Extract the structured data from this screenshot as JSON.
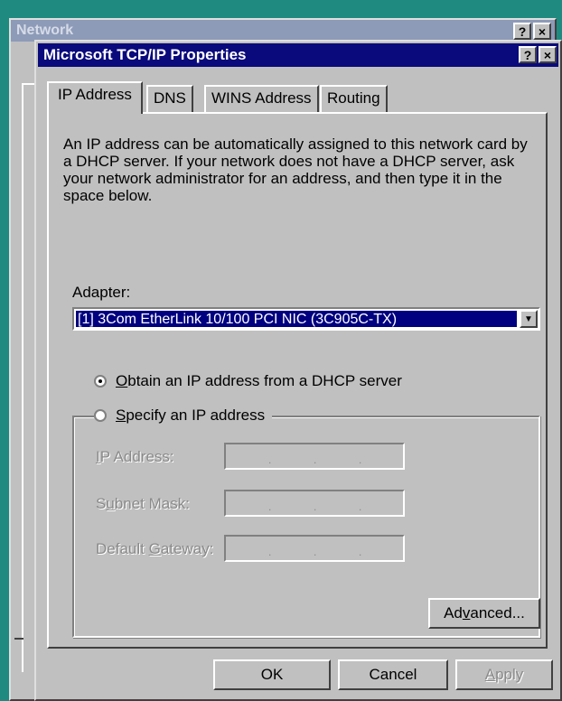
{
  "background_window": {
    "title": "Network",
    "help_label": "?",
    "close_label": "×"
  },
  "dialog": {
    "title": "Microsoft TCP/IP Properties",
    "help_label": "?",
    "close_label": "×"
  },
  "tabs": [
    {
      "label": "IP Address",
      "active": true
    },
    {
      "label": "DNS",
      "active": false
    },
    {
      "label": "WINS Address",
      "active": false
    },
    {
      "label": "Routing",
      "active": false
    }
  ],
  "description": "An IP address can be automatically assigned to this network card by a DHCP server.  If your network does not have a DHCP server, ask your network administrator for an address, and then type it in the space below.",
  "adapter": {
    "label": "Adapter:",
    "selected": "[1] 3Com EtherLink 10/100 PCI NIC (3C905C-TX)",
    "arrow": "▼"
  },
  "radios": {
    "dhcp": {
      "label_prefix": "",
      "label_key": "O",
      "label_rest": "btain an IP address from a DHCP server",
      "checked": true
    },
    "specify": {
      "label_prefix": "",
      "label_key": "S",
      "label_rest": "pecify an IP address",
      "checked": false
    }
  },
  "fields": {
    "ip": {
      "pre": "",
      "key": "I",
      "post": "P Address:",
      "value": ""
    },
    "subnet": {
      "pre": "S",
      "key": "u",
      "post": "bnet Mask:",
      "value": ""
    },
    "gateway": {
      "pre": "Default ",
      "key": "G",
      "post": "ateway:",
      "value": ""
    }
  },
  "ip_separator": ".",
  "buttons": {
    "advanced": {
      "pre": "Ad",
      "key": "v",
      "post": "anced..."
    },
    "ok": "OK",
    "cancel": "Cancel",
    "apply": {
      "pre": "",
      "key": "A",
      "post": "pply"
    }
  },
  "colors": {
    "desktop": "#1f8a80",
    "title_active": "#0a0a7c",
    "title_inactive": "#8d9bb8",
    "face": "#c0c0c0",
    "selection": "#000080"
  }
}
